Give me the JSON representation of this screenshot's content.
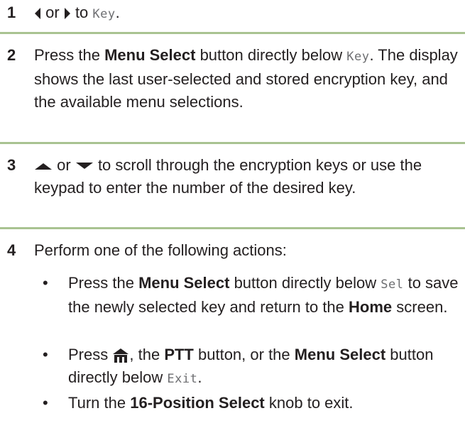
{
  "steps": [
    {
      "number": "1",
      "text": {
        "or": "or",
        "to": "to",
        "menu_item": "Key",
        "period": "."
      },
      "icons": [
        "left-arrow-icon",
        "right-arrow-icon"
      ]
    },
    {
      "number": "2",
      "text": {
        "press": "Press the",
        "button": "Menu Select",
        "below": "button directly below",
        "menu_item": "Key",
        "rest": ". The display shows the last user-selected and stored encryption key, and the available menu selections."
      }
    },
    {
      "number": "3",
      "text": {
        "or": "or",
        "rest": "to scroll through the encryption keys or use the keypad to enter the number of the desired key."
      },
      "icons": [
        "up-arrow-icon",
        "down-arrow-icon"
      ]
    },
    {
      "number": "4",
      "text": {
        "intro": "Perform one of the following actions:"
      },
      "bullets": [
        {
          "press": "Press the",
          "button": "Menu Select",
          "below": "button directly below",
          "menu_item": "Sel",
          "mid": "to save the newly selected key and return to the",
          "screen": "Home",
          "end": "screen."
        },
        {
          "press": "Press",
          "comma": ", the",
          "ptt": "PTT",
          "mid": "button, or the",
          "button": "Menu Select",
          "below": "button directly below",
          "menu_item": "Exit",
          "end": "."
        },
        {
          "turn": "Turn the",
          "knob": "16-Position Select",
          "end": "knob to exit."
        }
      ],
      "bullet_glyph": "•"
    }
  ],
  "colors": {
    "text": "#231f20",
    "rule": "#a9c391",
    "menu_text": "#6d6e71"
  }
}
